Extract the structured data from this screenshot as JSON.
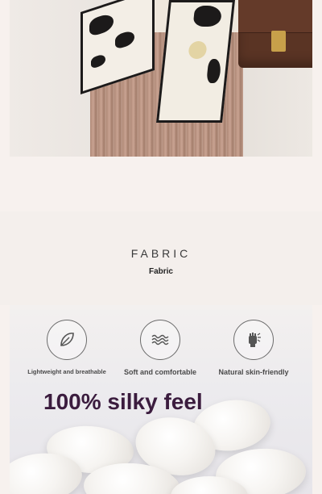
{
  "fabric_section": {
    "title_en": "FABRIC",
    "title_sub": "Fabric"
  },
  "features": [
    {
      "icon": "leaf-icon",
      "label": "Lightweight and breathable"
    },
    {
      "icon": "wave-icon",
      "label": "Soft and comfortable"
    },
    {
      "icon": "hand-icon",
      "label": "Natural skin-friendly"
    }
  ],
  "headline": "100% silky feel"
}
